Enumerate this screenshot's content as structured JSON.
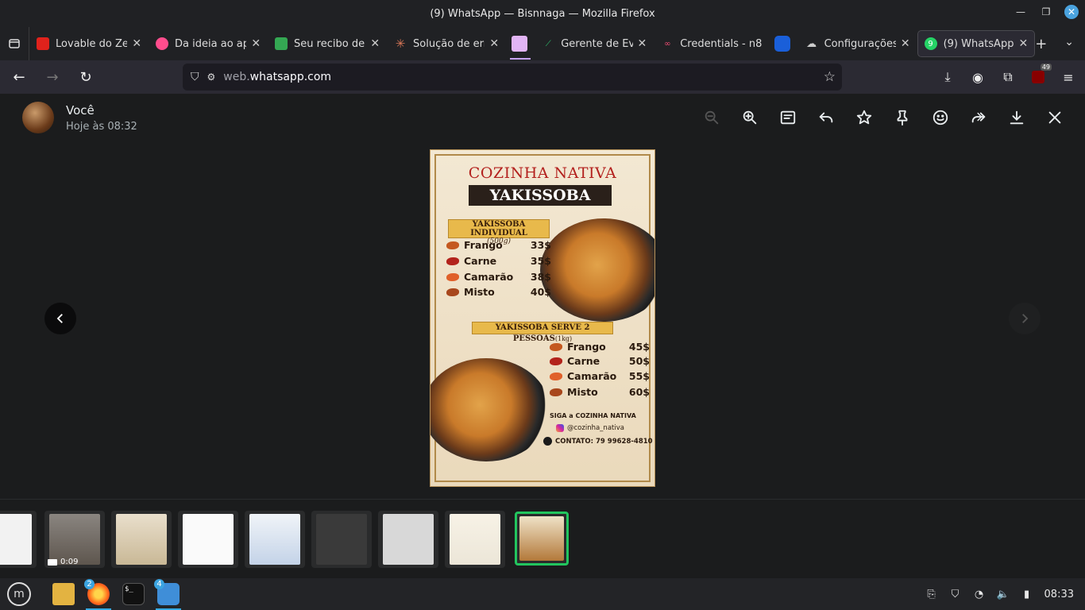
{
  "window": {
    "title": "(9) WhatsApp — Bisnnaga — Mozilla Firefox"
  },
  "tabs": [
    {
      "label": "Lovable do Zer",
      "color": "#e0221c",
      "icon": "lovable-icon"
    },
    {
      "label": "Da ideia ao apli",
      "color": "#ff4d8d",
      "icon": "heart-icon"
    },
    {
      "label": "Seu recibo de C",
      "color": "#34a853",
      "icon": "gmail-image-icon"
    },
    {
      "label": "Solução de erro",
      "color": "#d97757",
      "icon": "claude-icon"
    },
    {
      "label": "",
      "color": "#e2b4f5",
      "icon": "blank-tab-icon"
    },
    {
      "label": "Gerente de Evo",
      "color": "#2ecc71",
      "icon": "graph-icon"
    },
    {
      "label": "Credentials - n8",
      "color": "#ea4b71",
      "icon": "n8n-icon"
    },
    {
      "label": "",
      "color": "#1a5fd9",
      "icon": "blue-app-icon"
    },
    {
      "label": "Configurações",
      "color": "#cccccc",
      "icon": "cloud-icon"
    },
    {
      "label": "(9) WhatsApp",
      "color": "#25d366",
      "icon": "whatsapp-badge-icon",
      "badge": "9"
    }
  ],
  "address": {
    "sub": "web.",
    "domain": "whatsapp.com"
  },
  "extensions": {
    "badge_count": "49"
  },
  "viewer": {
    "sender_name": "Você",
    "sender_time": "Hoje às 08:32"
  },
  "poster": {
    "brand": "COZINHA NATIVA",
    "dish": "YAKISSOBA",
    "section1_title": "YAKISSOBA INDIVIDUAL",
    "section1_sub": "(500g)",
    "section1_items": [
      {
        "name": "Frango",
        "price": "33$"
      },
      {
        "name": "Carne",
        "price": "35$"
      },
      {
        "name": "Camarão",
        "price": "38$"
      },
      {
        "name": "Misto",
        "price": "40$"
      }
    ],
    "section2_title": "YAKISSOBA SERVE 2 PESSOAS",
    "section2_sub": "(1kg)",
    "section2_items": [
      {
        "name": "Frango",
        "price": "45$"
      },
      {
        "name": "Carne",
        "price": "50$"
      },
      {
        "name": "Camarão",
        "price": "55$"
      },
      {
        "name": "Misto",
        "price": "60$"
      }
    ],
    "follow": "SIGA a COZINHA NATIVA",
    "instagram": "@cozinha_nativa",
    "contact": "CONTATO: 79 99628-4810"
  },
  "thumbnails": {
    "video_duration": "0:09"
  },
  "taskbar": {
    "firefox_badge": "2",
    "screenshot_badge": "4",
    "clock": "08:33"
  }
}
